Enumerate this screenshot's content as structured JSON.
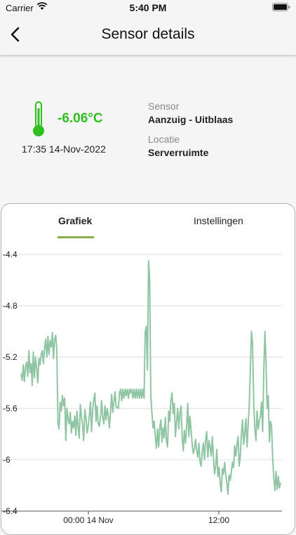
{
  "status_bar": {
    "carrier": "Carrier",
    "time": "5:40 PM"
  },
  "nav": {
    "title": "Sensor details",
    "back_icon": "chevron-left-icon"
  },
  "reading": {
    "temperature": "-6.06°C",
    "timestamp": "17:35 14-Nov-2022",
    "sensor_label": "Sensor",
    "sensor_value": "Aanzuig - Uitblaas",
    "location_label": "Locatie",
    "location_value": "Serverruimte"
  },
  "tabs": [
    {
      "label": "Grafiek",
      "active": true
    },
    {
      "label": "Instellingen",
      "active": false
    }
  ],
  "colors": {
    "temperature": "#2fbf1f",
    "line": "#8fc5a2",
    "tab_underline": "#8cae4a"
  },
  "chart_data": {
    "type": "line",
    "title": "",
    "xlabel": "",
    "ylabel": "",
    "ylim": [
      -6.4,
      -4.4
    ],
    "y_ticks": [
      "-4.4",
      "-4.8",
      "-5.2",
      "-5.6",
      "-6",
      "-6.4"
    ],
    "x_ticks": [
      "00:00 14 Nov",
      "12:00"
    ],
    "series": [
      {
        "values": [
          -5.33,
          -5.38,
          -5.26,
          -5.39,
          -5.28,
          -5.24,
          -5.35,
          -5.15,
          -5.32,
          -5.25,
          -5.42,
          -5.16,
          -5.36,
          -5.2,
          -5.29,
          -5.4,
          -5.21,
          -5.26,
          -5.18,
          -5.15,
          -5.25,
          -5.13,
          -5.06,
          -5.2,
          -5.04,
          -5.18,
          -5.07,
          -5.12,
          -5.01,
          -5.21,
          -5.06,
          -5.03,
          -5.14,
          -5.71,
          -5.76,
          -5.55,
          -5.62,
          -5.5,
          -5.58,
          -5.52,
          -5.85,
          -5.6,
          -5.68,
          -5.72,
          -5.63,
          -5.79,
          -5.7,
          -5.75,
          -5.66,
          -5.81,
          -5.62,
          -5.74,
          -5.83,
          -5.57,
          -5.66,
          -5.73,
          -5.85,
          -5.61,
          -5.67,
          -5.79,
          -5.74,
          -5.66,
          -5.55,
          -5.78,
          -5.61,
          -5.53,
          -5.48,
          -5.7,
          -5.58,
          -5.72,
          -5.74,
          -5.67,
          -5.54,
          -5.66,
          -5.72,
          -5.58,
          -5.69,
          -5.6,
          -5.66,
          -5.75,
          -5.62,
          -5.49,
          -5.63,
          -5.55,
          -5.47,
          -5.59,
          -5.59,
          -5.6,
          -5.48,
          -5.45,
          -5.54,
          -5.45,
          -5.52,
          -5.45,
          -5.5,
          -5.45,
          -5.52,
          -5.45,
          -5.48,
          -5.45,
          -5.52,
          -5.45,
          -5.52,
          -5.45,
          -5.52,
          -5.45,
          -5.52,
          -5.45,
          -5.52,
          -5.45,
          -5.52,
          -5.0,
          -4.96,
          -5.3,
          -4.45,
          -4.6,
          -5.5,
          -5.64,
          -5.75,
          -5.7,
          -5.82,
          -5.91,
          -5.76,
          -5.9,
          -5.75,
          -5.69,
          -5.86,
          -5.75,
          -5.83,
          -5.67,
          -5.85,
          -5.9,
          -5.62,
          -5.7,
          -5.53,
          -5.48,
          -5.64,
          -5.56,
          -5.82,
          -5.7,
          -5.6,
          -5.76,
          -5.64,
          -5.58,
          -5.82,
          -5.93,
          -5.77,
          -5.87,
          -5.75,
          -5.56,
          -5.82,
          -5.66,
          -5.77,
          -5.88,
          -5.95,
          -5.91,
          -5.84,
          -5.93,
          -5.98,
          -5.87,
          -6.02,
          -6.05,
          -5.93,
          -5.87,
          -6.0,
          -5.85,
          -5.78,
          -5.98,
          -5.85,
          -5.9,
          -5.97,
          -5.82,
          -5.98,
          -6.11,
          -6.05,
          -5.92,
          -6.13,
          -6.06,
          -6.18,
          -6.25,
          -6.07,
          -6.11,
          -6.02,
          -6.12,
          -6.18,
          -6.27,
          -6.12,
          -6.16,
          -6.1,
          -6.02,
          -6.06,
          -5.89,
          -5.97,
          -5.88,
          -5.82,
          -6.05,
          -5.97,
          -5.8,
          -5.69,
          -5.88,
          -5.79,
          -5.68,
          -5.9,
          -5.72,
          -5.58,
          -5.3,
          -5.0,
          -5.1,
          -5.55,
          -5.76,
          -5.85,
          -5.62,
          -5.76,
          -5.7,
          -5.66,
          -5.55,
          -5.78,
          -5.3,
          -5.0,
          -5.25,
          -5.6,
          -5.5,
          -5.86,
          -5.7,
          -5.74,
          -6.0,
          -6.14,
          -6.24,
          -6.09,
          -6.23,
          -6.13,
          -6.22,
          -6.18
        ]
      }
    ]
  }
}
